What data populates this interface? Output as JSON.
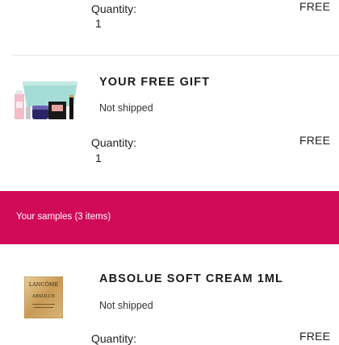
{
  "items": [
    {
      "title": "",
      "shipping": "",
      "quantity_label": "Quantity:",
      "quantity": "1",
      "price": "FREE"
    },
    {
      "title": "YOUR FREE GIFT",
      "shipping": "Not shipped",
      "quantity_label": "Quantity:",
      "quantity": "1",
      "price": "FREE",
      "image_icon": "gift-set-image"
    }
  ],
  "samples_banner": {
    "text": "Your samples (3 items)",
    "color": "#d10a57"
  },
  "samples": [
    {
      "title": "ABSOLUE SOFT CREAM 1ML",
      "shipping": "Not shipped",
      "quantity_label": "Quantity:",
      "price": "FREE",
      "image_icon": "sample-sachet-image",
      "brand": "LANCÔME",
      "product_line": "ABSOLUE"
    }
  ]
}
